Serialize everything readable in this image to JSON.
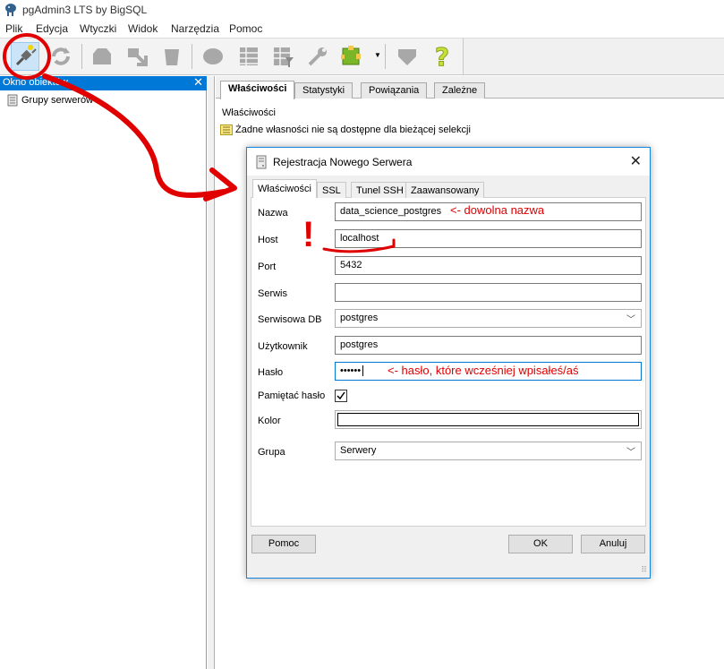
{
  "window": {
    "title": "pgAdmin3 LTS by BigSQL"
  },
  "menu": [
    "Plik",
    "Edycja",
    "Wtyczki",
    "Widok",
    "Narzędzia",
    "Pomoc"
  ],
  "toolbar": {
    "icons": [
      "plug-connect-icon",
      "refresh-icon",
      "object-icon",
      "properties-icon",
      "delete-icon",
      "sql-icon",
      "view-data-icon",
      "filter-data-icon",
      "maintenance-wrench-icon",
      "plugin-icon",
      "hint-icon",
      "help-icon"
    ]
  },
  "left_panel": {
    "header": "Okno obiektów",
    "tree_item": "Grupy serwerów"
  },
  "right_pane": {
    "tabs": [
      "Właściwości",
      "Statystyki",
      "Powiązania",
      "Zależne"
    ],
    "heading": "Właściwości",
    "note": "Żadne własności nie są dostępne dla bieżącej selekcji"
  },
  "dialog": {
    "title": "Rejestracja Nowego Serwera",
    "tabs": [
      "Właściwości",
      "SSL",
      "Tunel SSH",
      "Zaawansowany"
    ],
    "fields": {
      "name": {
        "label": "Nazwa",
        "value": "data_science_postgres"
      },
      "host": {
        "label": "Host",
        "value": "localhost"
      },
      "port": {
        "label": "Port",
        "value": "5432"
      },
      "service": {
        "label": "Serwis",
        "value": ""
      },
      "maintenance_db": {
        "label": "Serwisowa DB",
        "value": "postgres"
      },
      "username": {
        "label": "Użytkownik",
        "value": "postgres"
      },
      "password": {
        "label": "Hasło",
        "value": "••••••"
      },
      "store_password": {
        "label": "Pamiętać hasło",
        "checked": true
      },
      "colour": {
        "label": "Kolor"
      },
      "group": {
        "label": "Grupa",
        "value": "Serwery"
      }
    },
    "buttons": {
      "help": "Pomoc",
      "ok": "OK",
      "cancel": "Anuluj"
    }
  },
  "annotations": {
    "name_note": "<- dowolna nazwa",
    "password_note": "<- hasło, które wcześniej wpisałeś/aś",
    "exclamation": "!",
    "color": "#e00000"
  }
}
